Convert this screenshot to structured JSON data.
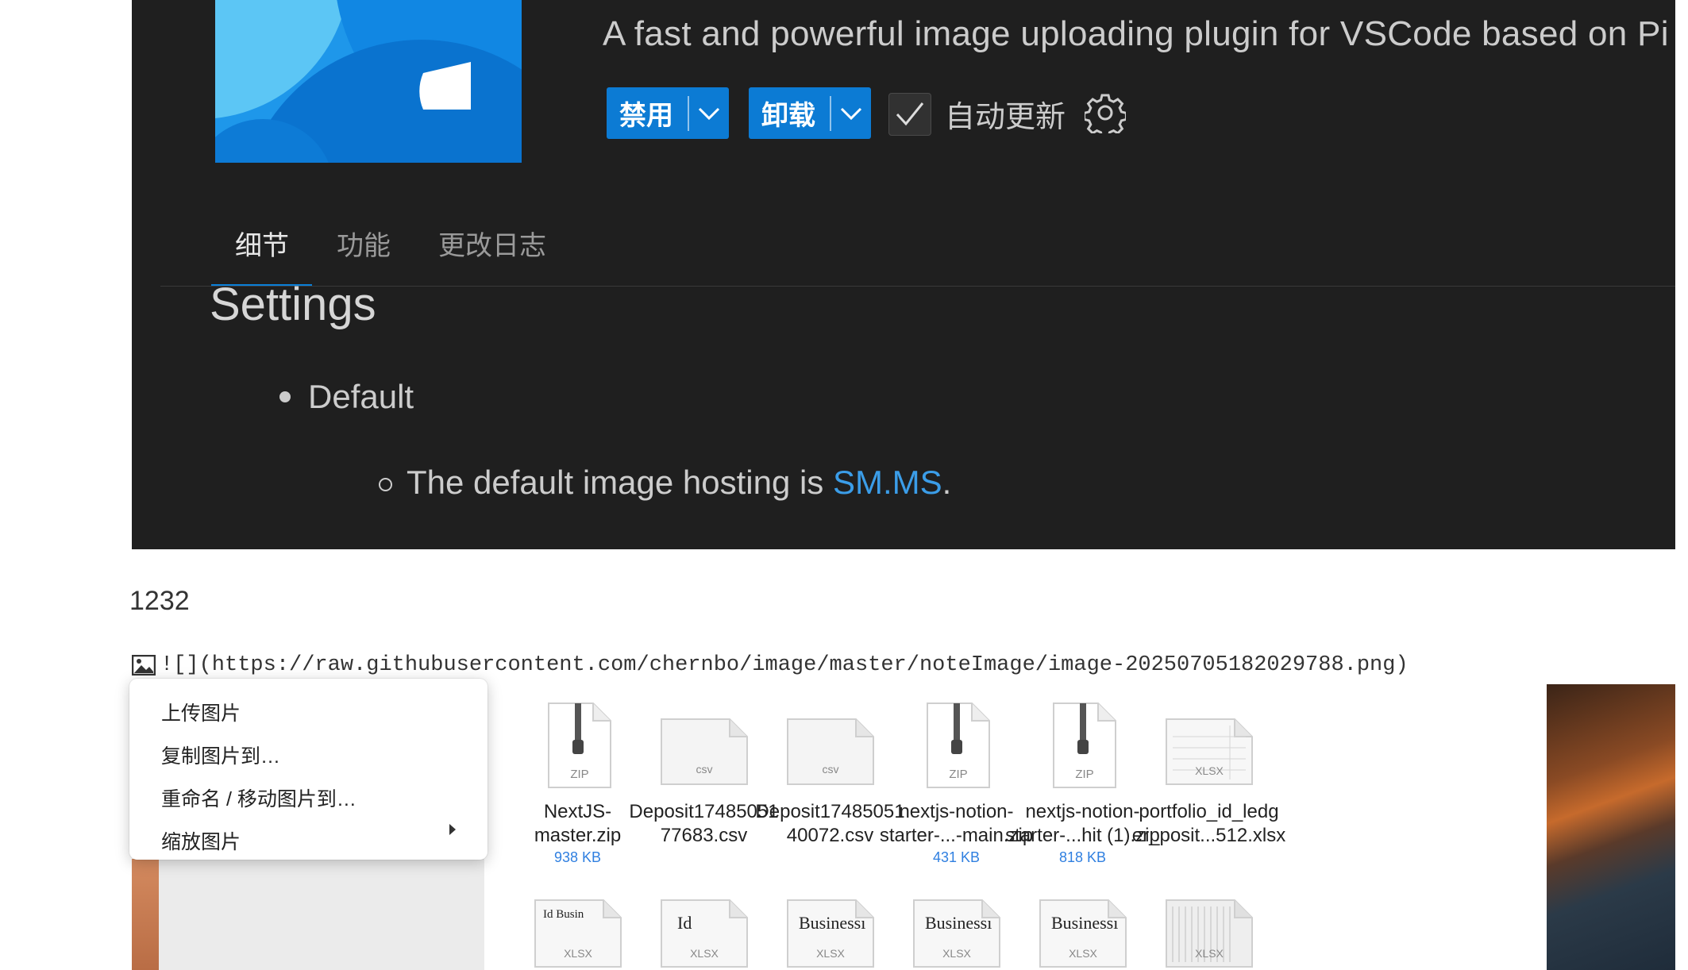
{
  "extension": {
    "description": "A fast and powerful image uploading plugin for VSCode based on Pi",
    "buttons": {
      "disable_label": "禁用",
      "uninstall_label": "卸载"
    },
    "auto_update_label": "自动更新",
    "auto_update_checked": true,
    "accent_color": "#0c7bd4"
  },
  "tabs": [
    {
      "label": "细节",
      "active": true
    },
    {
      "label": "功能",
      "active": false
    },
    {
      "label": "更改日志",
      "active": false
    }
  ],
  "readme": {
    "heading": "Settings",
    "bullet": "Default",
    "sub_bullet_prefix": "The default image hosting is ",
    "sub_bullet_link": "SM.MS",
    "sub_bullet_suffix": "."
  },
  "editor": {
    "line_text": "1232",
    "image_markdown": "![](https://raw.githubusercontent.com/chernbo/image/master/noteImage/image-20250705182029788.png)"
  },
  "context_menu": {
    "items": [
      "上传图片",
      "复制图片到…",
      "重命名 / 移动图片到…",
      "缩放图片"
    ]
  },
  "files": [
    {
      "name_line1": "NextJS-",
      "name_line2": "master.zip",
      "size": "938 KB",
      "icon": "zip-file-icon",
      "badge": "ZIP"
    },
    {
      "name_line1": "Deposit17485051",
      "name_line2": "77683.csv",
      "size": "",
      "icon": "csv-file-icon",
      "badge": "csv"
    },
    {
      "name_line1": "Deposit17485051",
      "name_line2": "40072.csv",
      "size": "",
      "icon": "csv-file-icon",
      "badge": "csv"
    },
    {
      "name_line1": "nextjs-notion-",
      "name_line2": "starter-...-main.zip",
      "size": "431 KB",
      "icon": "zip-file-icon",
      "badge": "ZIP"
    },
    {
      "name_line1": "nextjs-notion-",
      "name_line2": "starter-...hit (1).zip",
      "size": "818 KB",
      "icon": "zip-file-icon",
      "badge": "ZIP"
    },
    {
      "name_line1": "portfolio_id_ledg",
      "name_line2": "er_posit...512.xlsx",
      "size": "",
      "icon": "xlsx-file-icon",
      "badge": "XLSX"
    }
  ],
  "file_row2": [
    {
      "badge": "XLSX",
      "preview": "Id  Busin",
      "icon": "xlsx-file-icon"
    },
    {
      "badge": "XLSX",
      "preview": "Id",
      "icon": "xlsx-file-icon"
    },
    {
      "badge": "XLSX",
      "preview": "Businessı",
      "icon": "xlsx-file-icon"
    },
    {
      "badge": "XLSX",
      "preview": "Businessı",
      "icon": "xlsx-file-icon"
    },
    {
      "badge": "XLSX",
      "preview": "Businessı",
      "icon": "xlsx-file-icon"
    },
    {
      "badge": "XLSX",
      "preview": "",
      "icon": "xlsx-file-icon"
    }
  ]
}
